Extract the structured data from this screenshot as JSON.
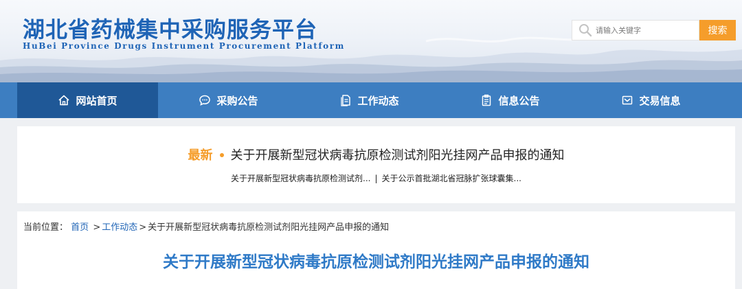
{
  "header": {
    "title": "湖北省药械集中采购服务平台",
    "subtitle": "HuBei Province Drugs Instrument Procurement Platform"
  },
  "search": {
    "placeholder": "请输入关键字",
    "button_label": "搜索",
    "icon": "search-icon"
  },
  "nav": {
    "items": [
      {
        "label": "网站首页",
        "icon": "home-icon",
        "active": true
      },
      {
        "label": "采购公告",
        "icon": "chat-bubble-icon",
        "active": false
      },
      {
        "label": "工作动态",
        "icon": "document-icon",
        "active": false
      },
      {
        "label": "信息公告",
        "icon": "clipboard-icon",
        "active": false
      },
      {
        "label": "交易信息",
        "icon": "mail-icon",
        "active": false
      }
    ]
  },
  "latest": {
    "tag": "最新",
    "title": "关于开展新型冠状病毒抗原检测试剂阳光挂网产品申报的通知",
    "links": [
      "关于开展新型冠状病毒抗原检测试剂...",
      "关于公示首批湖北省冠脉扩张球囊集..."
    ],
    "separator": "|"
  },
  "breadcrumb": {
    "prefix": "当前位置：",
    "home": "首页",
    "section": "工作动态",
    "current": "关于开展新型冠状病毒抗原检测试剂阳光挂网产品申报的通知"
  },
  "article": {
    "title": "关于开展新型冠状病毒抗原检测试剂阳光挂网产品申报的通知"
  },
  "colors": {
    "brand_blue": "#1f64b6",
    "nav_blue": "#3d7ec1",
    "nav_active": "#1f5897",
    "accent_orange": "#f59d2b",
    "article_title_blue": "#2f7ac7"
  }
}
